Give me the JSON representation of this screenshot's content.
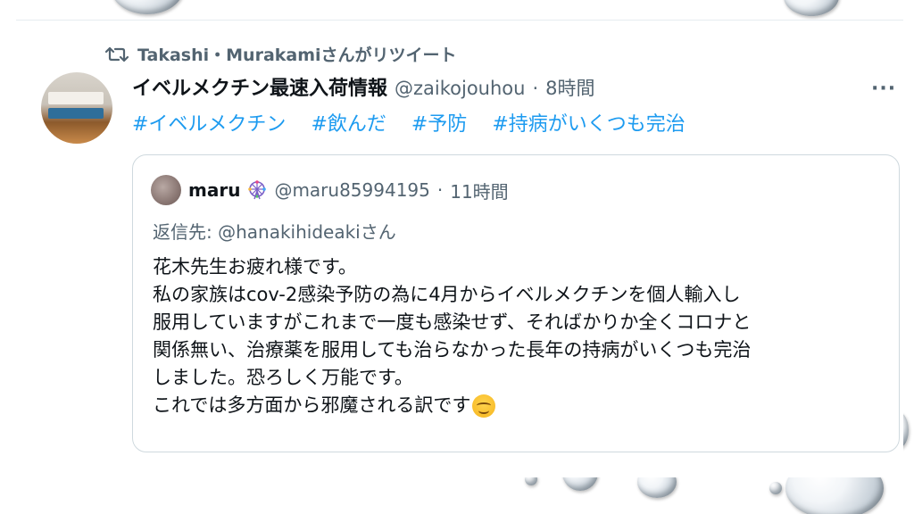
{
  "retweet": {
    "text": "Takashi・Murakamiさんがリツイート",
    "icon": "retweet-icon"
  },
  "tweet": {
    "display_name": "イベルメクチン最速入荷情報",
    "handle": "@zaikojouhou",
    "separator": "·",
    "time": "8時間",
    "more": "···",
    "hashtags": [
      "#イベルメクチン",
      "#飲んだ",
      "#予防",
      "#持病がいくつも完治"
    ]
  },
  "quote": {
    "name": "maru",
    "handle": "@maru85994195",
    "separator": "·",
    "time": "11時間",
    "reply_to": "返信先: @hanakihideakiさん",
    "lines": [
      "花木先生お疲れ様です。",
      "私の家族はcov-2感染予防の為に4月からイベルメクチンを個人輸入し",
      "服用していますがこれまで一度も感染せず、そればかりか全くコロナと",
      "関係無い、治療薬を服用しても治らなかった長年の持病がいくつも完治",
      "しました。恐ろしく万能です。",
      "これでは多方面から邪魔される訳です"
    ],
    "emoji": "smiling-face-icon"
  },
  "colors": {
    "link": "#1d9bf0",
    "secondary_text": "#536471",
    "primary_text": "#0f1419",
    "border": "#cfd9de"
  }
}
